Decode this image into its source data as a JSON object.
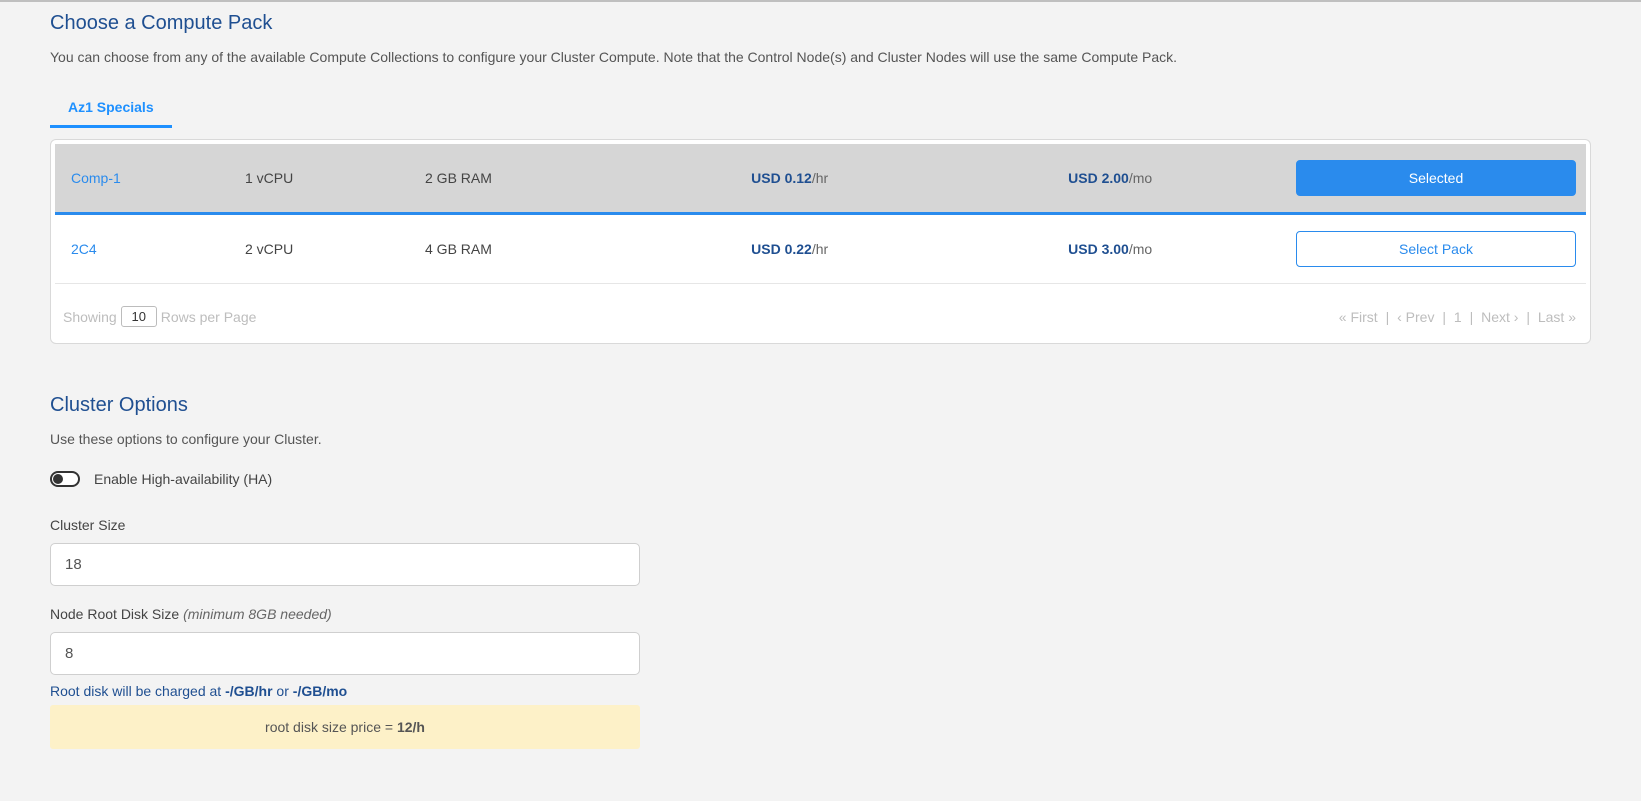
{
  "compute": {
    "title": "Choose a Compute Pack",
    "desc": "You can choose from any of the available Compute Collections to configure your Cluster Compute. Note that the Control Node(s) and Cluster Nodes will use the same Compute Pack.",
    "tabs": [
      {
        "label": "Az1 Specials"
      }
    ],
    "packs": [
      {
        "name": "Comp-1",
        "vcpu": "1 vCPU",
        "ram": "2 GB RAM",
        "hr_price": "USD 0.12",
        "hr_unit": "/hr",
        "mo_price": "USD 2.00",
        "mo_unit": "/mo",
        "button": "Selected",
        "selected": true
      },
      {
        "name": "2C4",
        "vcpu": "2 vCPU",
        "ram": "4 GB RAM",
        "hr_price": "USD 0.22",
        "hr_unit": "/hr",
        "mo_price": "USD 3.00",
        "mo_unit": "/mo",
        "button": "Select Pack",
        "selected": false
      }
    ],
    "footer": {
      "showing": "Showing",
      "rows_value": "10",
      "rows_label": "Rows per Page",
      "first": "« First",
      "prev": "‹  Prev",
      "page": "1",
      "next": "Next  ›",
      "last": "Last »",
      "sep": "|"
    }
  },
  "options": {
    "title": "Cluster Options",
    "desc": "Use these options to configure your Cluster.",
    "ha_label": "Enable High-availability (HA)",
    "cluster_size_label": "Cluster Size",
    "cluster_size_value": "18",
    "disk_label_main": "Node Root Disk Size ",
    "disk_label_note": "(minimum 8GB needed)",
    "disk_value": "8",
    "disk_help_prefix": "Root disk will be charged at ",
    "disk_help_rate1": "-/GB/hr",
    "disk_help_mid": " or ",
    "disk_help_rate2": "-/GB/mo",
    "banner_prefix": "root disk size price = ",
    "banner_value": "12/h"
  }
}
